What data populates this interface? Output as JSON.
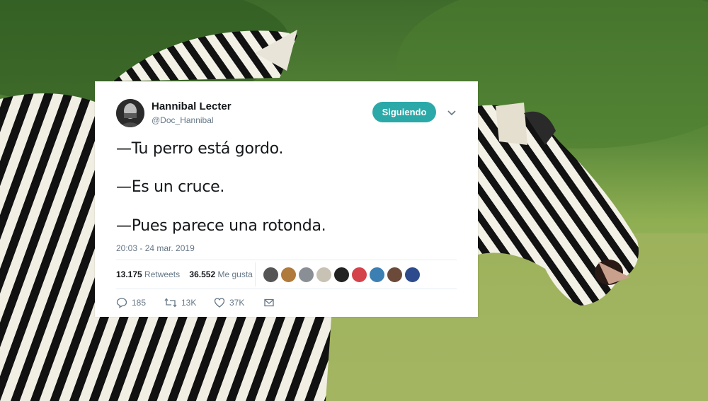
{
  "tweet": {
    "author_name": "Hannibal Lecter",
    "author_handle": "@Doc_Hannibal",
    "follow_label": "Siguiendo",
    "lines": [
      "—Tu perro está gordo.",
      "—Es un cruce.",
      "—Pues parece una rotonda."
    ],
    "timestamp": "20:03 - 24 mar. 2019",
    "retweets_count": "13.175",
    "retweets_label": "Retweets",
    "likes_count": "36.552",
    "likes_label": "Me gusta",
    "actions": {
      "reply_count": "185",
      "retweet_count": "13K",
      "like_count": "37K"
    }
  },
  "colors": {
    "accent": "#2ba9a9",
    "text": "#14171a",
    "muted": "#657786"
  },
  "icons": [
    "chevron-down-icon",
    "reply-icon",
    "retweet-icon",
    "heart-icon",
    "message-icon"
  ]
}
